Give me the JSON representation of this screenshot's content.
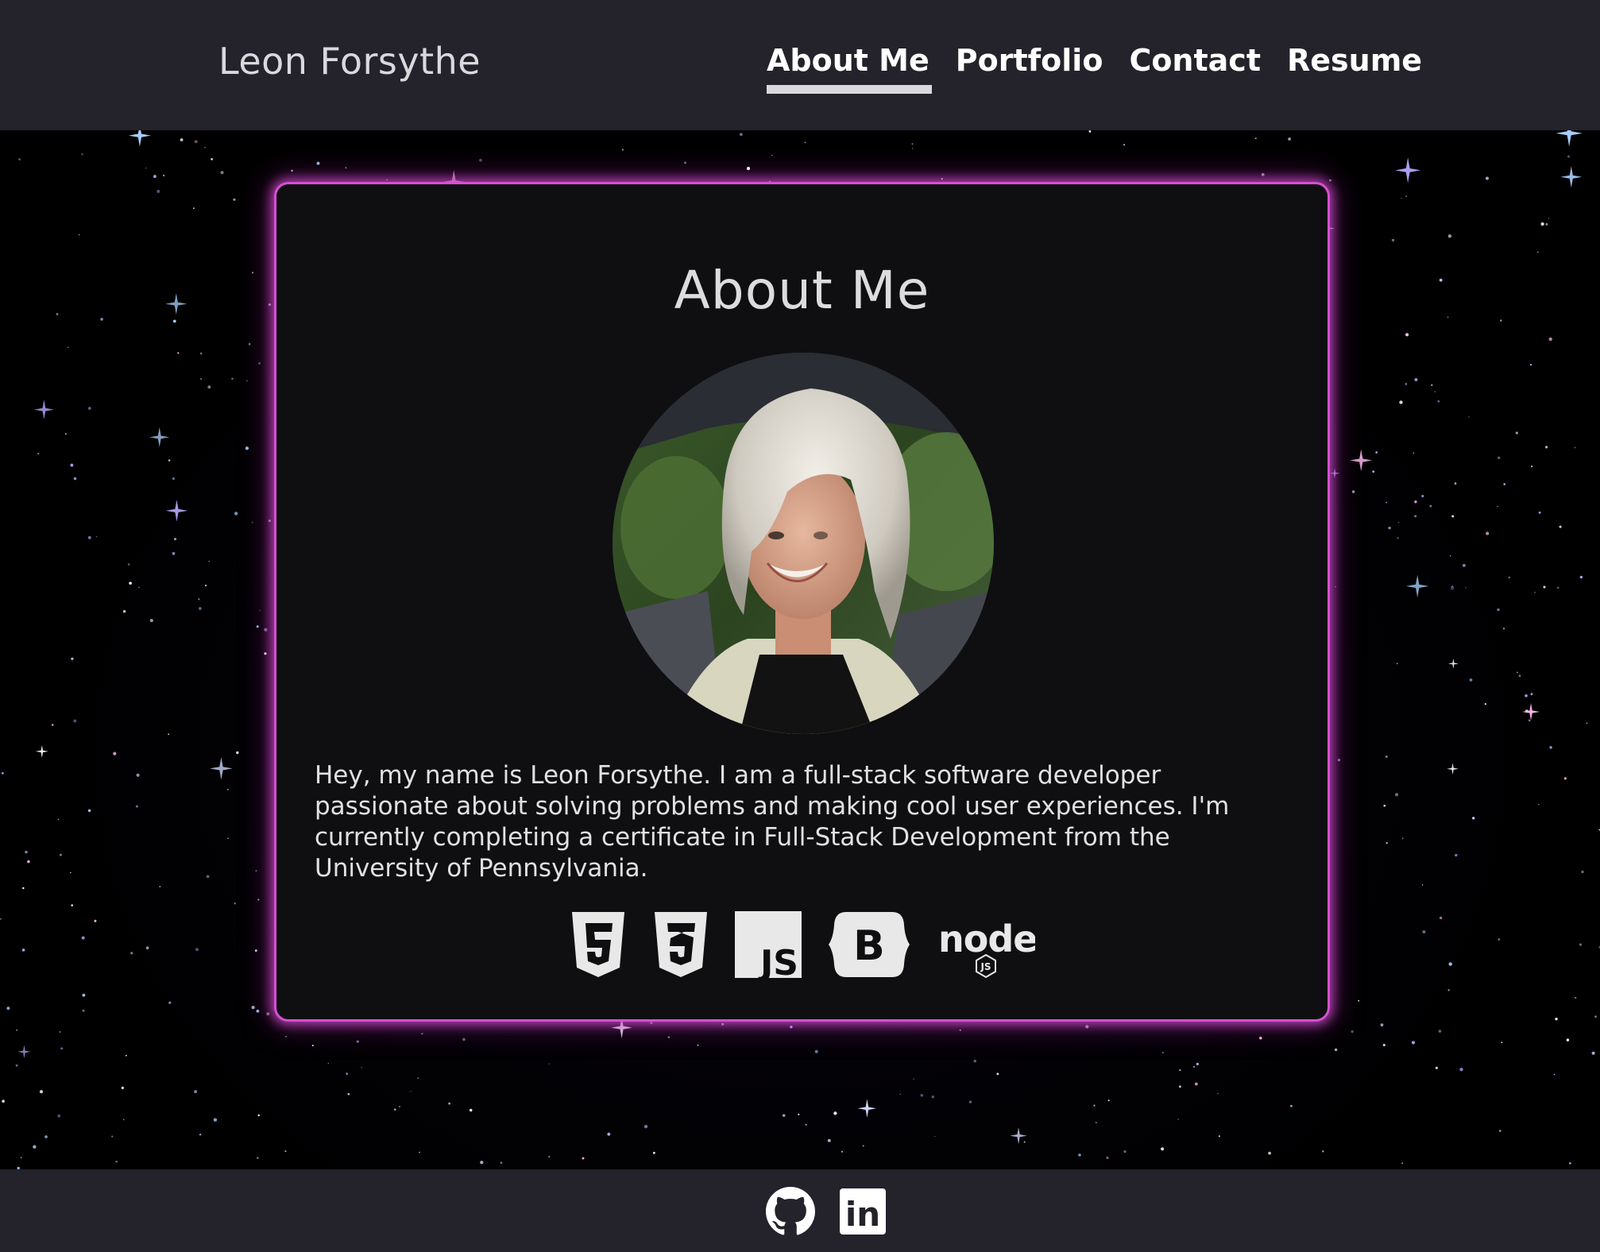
{
  "header": {
    "brand": "Leon Forsythe",
    "nav": [
      {
        "label": "About Me",
        "active": true
      },
      {
        "label": "Portfolio",
        "active": false
      },
      {
        "label": "Contact",
        "active": false
      },
      {
        "label": "Resume",
        "active": false
      }
    ]
  },
  "about": {
    "title": "About Me",
    "bio": "Hey, my name is Leon Forsythe. I am a full-stack software developer passionate about solving problems and making cool user experiences. I'm currently completing a certificate in Full-Stack Development from the University of Pennsylvania.",
    "tech_icons": [
      "html5-icon",
      "css3-icon",
      "javascript-icon",
      "bootstrap-icon",
      "nodejs-icon"
    ],
    "tech_icon_text": {
      "js": "JS",
      "bootstrap": "B",
      "node": "node",
      "node_badge": "JS"
    }
  },
  "footer": {
    "social_icons": [
      "github-icon",
      "linkedin-icon"
    ],
    "linkedin_text": "in"
  },
  "colors": {
    "header_bg": "#24222a",
    "card_bg": "#0f0f12",
    "card_glow": "#d64fd1",
    "text_light": "#dcdcdf"
  }
}
